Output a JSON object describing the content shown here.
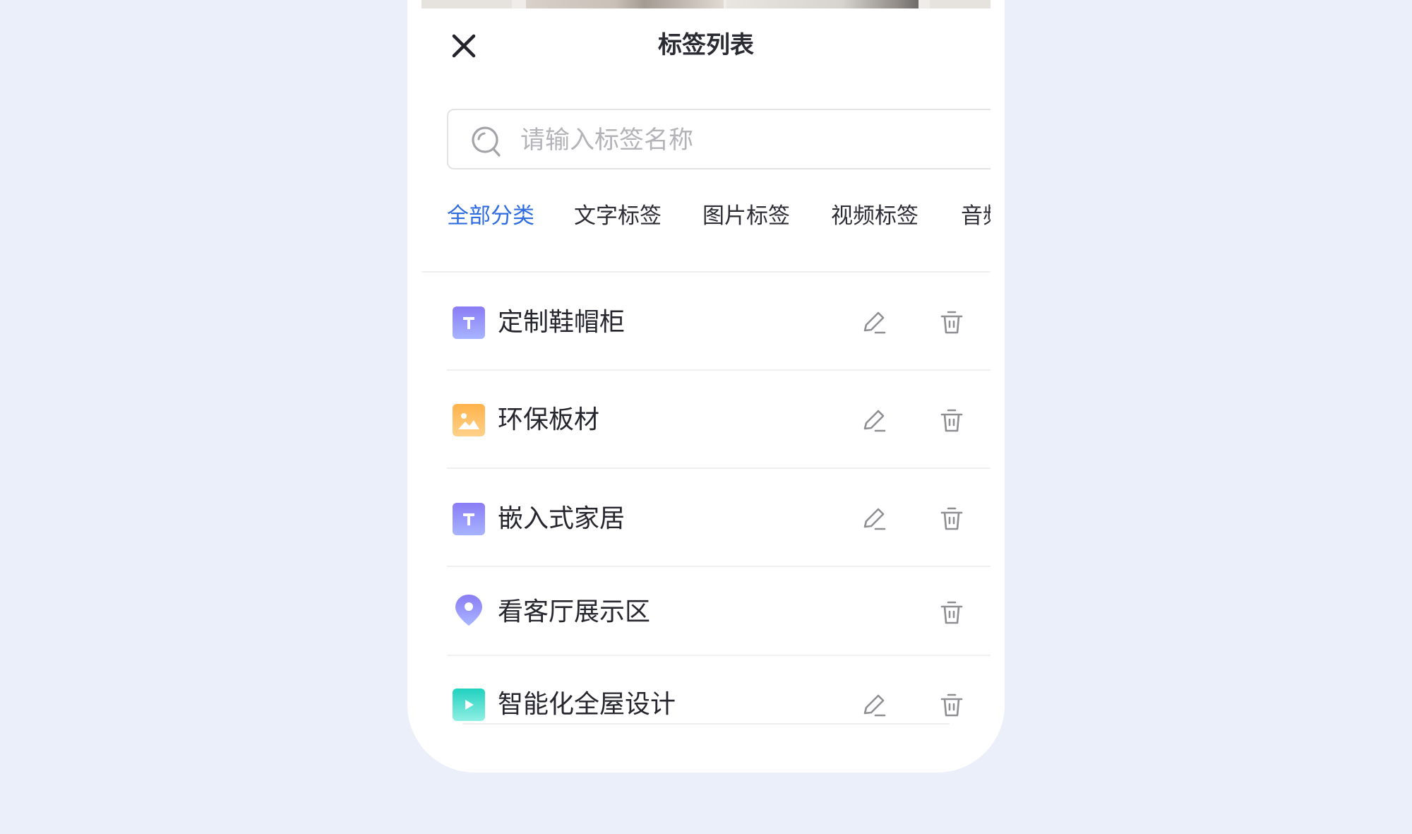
{
  "sheet": {
    "title": "标签列表"
  },
  "search": {
    "placeholder": "请输入标签名称",
    "value": ""
  },
  "tabs": [
    {
      "label": "全部分类",
      "active": true
    },
    {
      "label": "文字标签",
      "active": false
    },
    {
      "label": "图片标签",
      "active": false
    },
    {
      "label": "视频标签",
      "active": false
    },
    {
      "label": "音频标签",
      "active": false
    }
  ],
  "tags": [
    {
      "name": "定制鞋帽柜",
      "type": "text",
      "icon": "text-tag-icon",
      "editable": true
    },
    {
      "name": "环保板材",
      "type": "image",
      "icon": "image-tag-icon",
      "editable": true
    },
    {
      "name": "嵌入式家居",
      "type": "text",
      "icon": "text-tag-icon",
      "editable": true
    },
    {
      "name": "看客厅展示区",
      "type": "location",
      "icon": "location-tag-icon",
      "editable": false
    },
    {
      "name": "智能化全屋设计",
      "type": "video",
      "icon": "video-tag-icon",
      "editable": true
    }
  ],
  "colors": {
    "page_background": "#ebeffa",
    "accent": "#2f6ce0",
    "text_tag": "#8a7cf5",
    "image_tag": "#ffb24a",
    "video_tag": "#21d1c0",
    "location_tag": "#8f7ff7",
    "action_icon": "#8e8e93"
  }
}
